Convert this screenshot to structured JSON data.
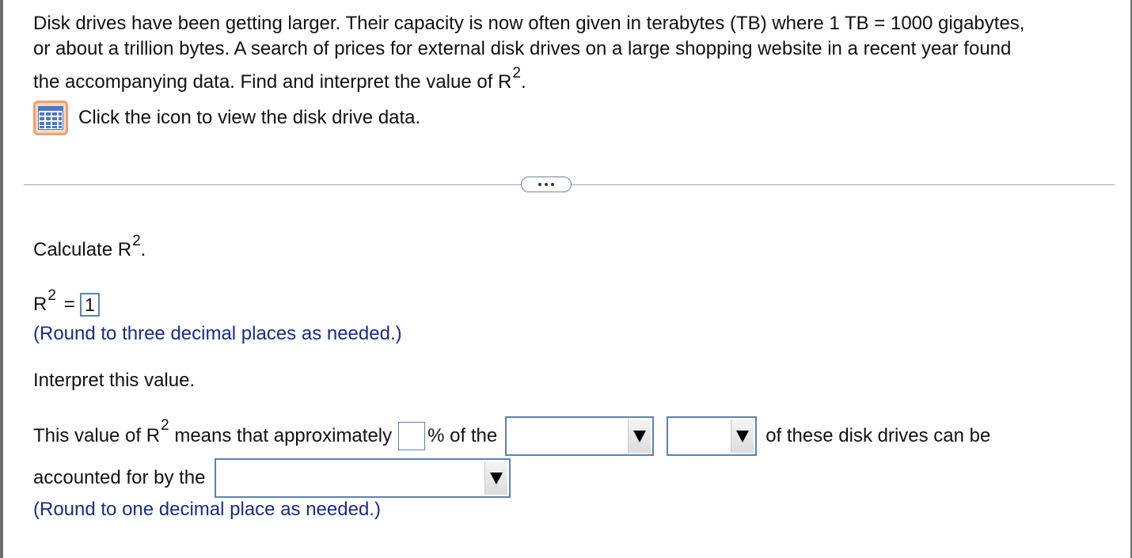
{
  "question": {
    "line1": "Disk drives have been getting larger. Their capacity is now often given in terabytes (TB) where 1 TB = 1000 gigabytes,",
    "line2": "or about a trillion bytes. A search of prices for external disk drives on a large shopping website in a recent year found",
    "line3": "the accompanying data. Find and interpret the value of R",
    "line3_sup": "2",
    "line3_end": "."
  },
  "data_link": {
    "icon": "grid-icon",
    "text": "Click the icon to view the disk drive data."
  },
  "more_button_icon": "ellipsis-icon",
  "calc": {
    "label": "Calculate R",
    "sup": "2",
    "end": "."
  },
  "r2": {
    "label": "R",
    "sup": "2",
    "eq": "=",
    "value": "1"
  },
  "hint1": "(Round to three decimal places as needed.)",
  "interp_label": "Interpret this value.",
  "sentence": {
    "part1": "This value of R",
    "sup": "2",
    "part2": " means that approximately",
    "part3": "% of the",
    "part4": "of these disk drives can be",
    "part5": "accounted for by the",
    "pct_value": "",
    "dropdown1": "",
    "dropdown2": "",
    "dropdown3": ""
  },
  "hint2": "(Round to one decimal place as needed.)"
}
